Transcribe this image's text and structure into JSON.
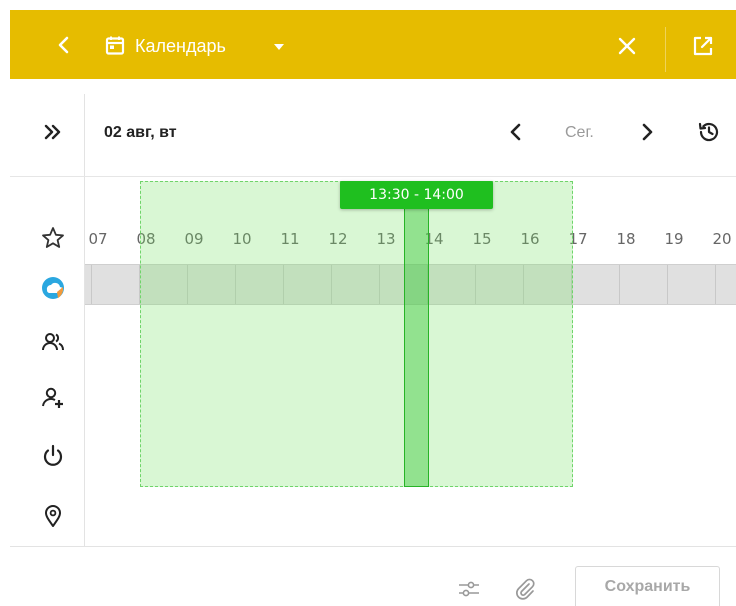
{
  "header": {
    "title": "Календарь",
    "bg_color": "#e6bc00",
    "icons": [
      "chevron-left-icon",
      "calendar-icon",
      "caret-down-icon",
      "close-icon",
      "open-external-icon"
    ]
  },
  "toolbar": {
    "date": "02 авг, вт",
    "today_label": "Сег.",
    "icons": [
      "double-chevron-right-icon",
      "chevron-left-icon",
      "chevron-right-icon",
      "history-icon"
    ]
  },
  "sidebar": {
    "icons": [
      "star-icon",
      "cloud-app-icon",
      "participants-icon",
      "add-participant-icon",
      "power-icon",
      "location-icon"
    ]
  },
  "timeline": {
    "hours": [
      "07",
      "08",
      "09",
      "10",
      "11",
      "12",
      "13",
      "14",
      "15",
      "16",
      "17",
      "18",
      "19",
      "20"
    ],
    "selected_slot": "13:30 - 14:00",
    "working_range": "08 - 17",
    "range_color": "#78e164",
    "slot_color": "#1fbf1f"
  },
  "footer": {
    "save_label": "Сохранить",
    "icons": [
      "settings-sliders-icon",
      "attachment-icon"
    ]
  }
}
